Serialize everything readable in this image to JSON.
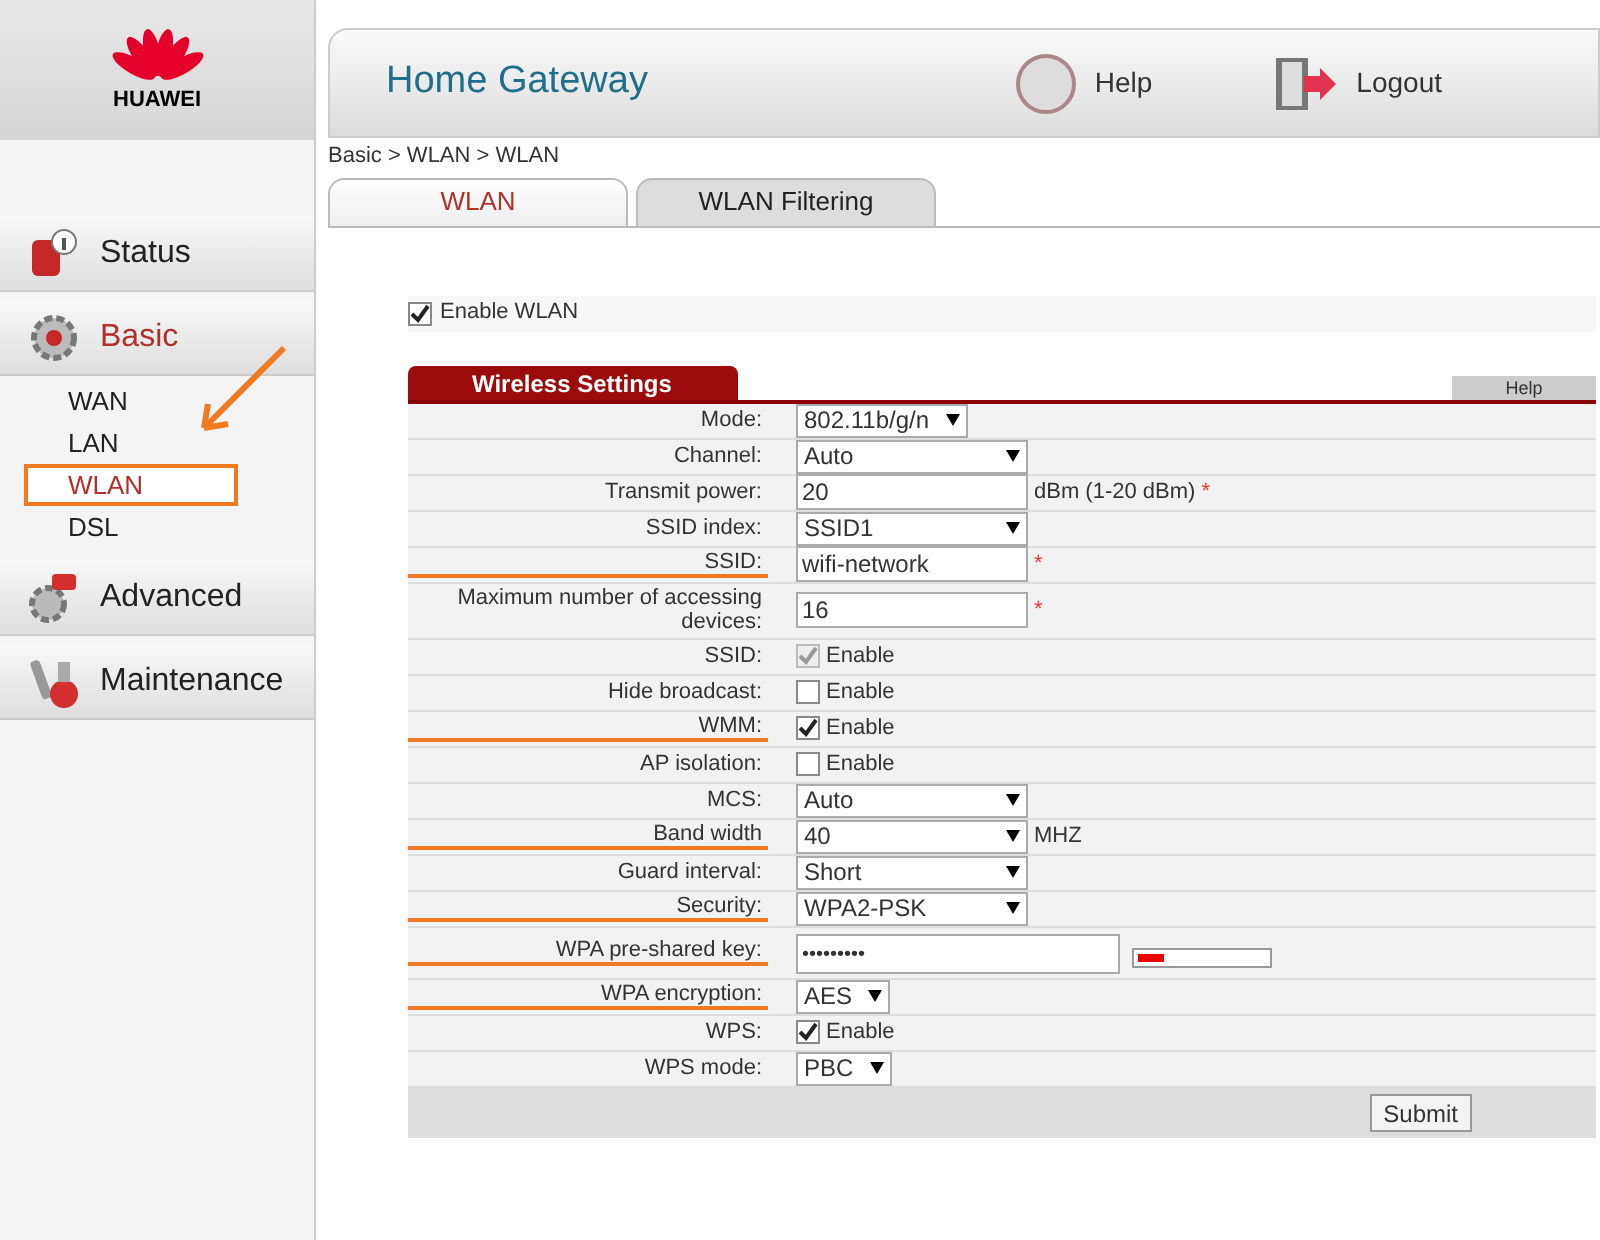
{
  "logo": {
    "text": "HUAWEI"
  },
  "header": {
    "title": "Home Gateway",
    "help": "Help",
    "logout": "Logout"
  },
  "breadcrumb": "Basic > WLAN > WLAN",
  "sidebar": {
    "items": [
      {
        "label": "Status",
        "selected": false
      },
      {
        "label": "Basic",
        "selected": true,
        "children": [
          {
            "label": "WAN",
            "selected": false,
            "highlighted": false
          },
          {
            "label": "LAN",
            "selected": false,
            "highlighted": false
          },
          {
            "label": "WLAN",
            "selected": true,
            "highlighted": true
          },
          {
            "label": "DSL",
            "selected": false,
            "highlighted": false
          }
        ]
      },
      {
        "label": "Advanced",
        "selected": false
      },
      {
        "label": "Maintenance",
        "selected": false
      }
    ]
  },
  "tabs": [
    {
      "label": "WLAN",
      "selected": true
    },
    {
      "label": "WLAN Filtering",
      "selected": false
    }
  ],
  "enable_wlan": {
    "label": "Enable WLAN",
    "checked": true
  },
  "section": {
    "title": "Wireless Settings",
    "help": "Help"
  },
  "rows": [
    {
      "label": "Mode:",
      "kind": "select",
      "value": "802.11b/g/n",
      "compact": true,
      "highlighted": false
    },
    {
      "label": "Channel:",
      "kind": "select",
      "value": "Auto",
      "compact": false,
      "highlighted": false
    },
    {
      "label": "Transmit power:",
      "kind": "text",
      "value": "20",
      "suffix": "dBm (1-20 dBm)",
      "required_mark": "*",
      "highlighted": false
    },
    {
      "label": "SSID index:",
      "kind": "select",
      "value": "SSID1",
      "compact": false,
      "highlighted": false
    },
    {
      "label": "SSID:",
      "kind": "text",
      "value": "wifi-network",
      "required_mark": "*",
      "highlighted": true
    },
    {
      "label": "Maximum number of accessing devices:",
      "kind": "text",
      "value": "16",
      "required_mark": "*",
      "highlighted": false
    },
    {
      "label": "SSID:",
      "kind": "checkbox",
      "value": "Enable",
      "checked": true,
      "disabled": true,
      "highlighted": false
    },
    {
      "label": "Hide broadcast:",
      "kind": "checkbox",
      "value": "Enable",
      "checked": false,
      "disabled": false,
      "highlighted": false
    },
    {
      "label": "WMM:",
      "kind": "checkbox",
      "value": "Enable",
      "checked": true,
      "disabled": false,
      "highlighted": true
    },
    {
      "label": "AP isolation:",
      "kind": "checkbox",
      "value": "Enable",
      "checked": false,
      "disabled": false,
      "highlighted": false
    },
    {
      "label": "MCS:",
      "kind": "select",
      "value": "Auto",
      "compact": false,
      "highlighted": false
    },
    {
      "label": "Band width",
      "kind": "select",
      "value": "40",
      "suffix": "MHZ",
      "compact": false,
      "highlighted": true
    },
    {
      "label": "Guard interval:",
      "kind": "select",
      "value": "Short",
      "compact": false,
      "highlighted": false
    },
    {
      "label": "Security:",
      "kind": "select",
      "value": "WPA2-PSK",
      "compact": false,
      "highlighted": true
    },
    {
      "label": "WPA pre-shared key:",
      "kind": "password",
      "value": "•••••••••",
      "level": 0.2,
      "highlighted": true
    },
    {
      "label": "WPA encryption:",
      "kind": "select",
      "value": "AES",
      "compact": true,
      "highlighted": true
    },
    {
      "label": "WPS:",
      "kind": "checkbox",
      "value": "Enable",
      "checked": true,
      "disabled": false,
      "highlighted": false
    },
    {
      "label": "WPS mode:",
      "kind": "select",
      "value": "PBC",
      "compact": true,
      "highlighted": false
    }
  ],
  "submit": "Submit"
}
